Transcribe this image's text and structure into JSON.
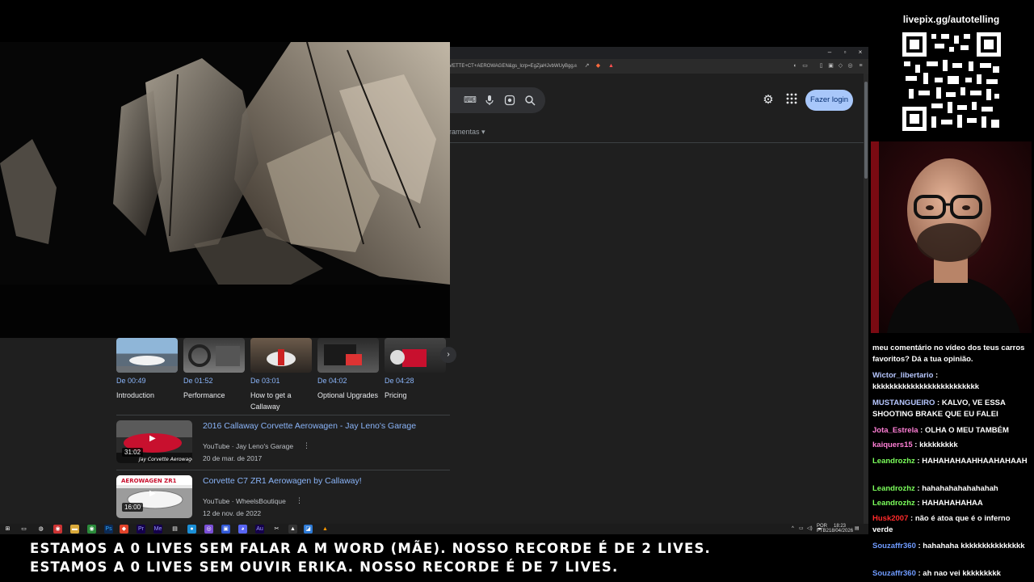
{
  "browser": {
    "url": "VETTE+CT+AEROWAGEN&gs_lcrp=EgZjaHJvbWUyBgg...",
    "tools_label": "ramentas",
    "login_label": "Fazer login",
    "window_controls": [
      "–",
      "▫",
      "×"
    ]
  },
  "chapters": [
    {
      "time": "De 00:49",
      "title": "Introduction"
    },
    {
      "time": "De 01:52",
      "title": "Performance"
    },
    {
      "time": "De 03:01",
      "title": "How to get a Callaway"
    },
    {
      "time": "De 04:02",
      "title": "Optional Upgrades"
    },
    {
      "time": "De 04:28",
      "title": "Pricing"
    }
  ],
  "results": [
    {
      "title": "2016 Callaway Corvette Aerowagen - Jay Leno's Garage",
      "source": "YouTube · Jay Leno's Garage",
      "date": "20 de mar. de 2017",
      "duration": "31:02"
    },
    {
      "title": "Corvette C7 ZR1 Aerowagen by Callaway!",
      "source": "YouTube · WheelsBoutique",
      "date": "12 de nov. de 2022",
      "duration": "16:00"
    }
  ],
  "taskbar": {
    "lang_top": "POR",
    "lang_bottom": "PTB2",
    "time": "18:23",
    "date": "18/04/2026"
  },
  "ticker": {
    "line1": "ESTAMOS A 0 LIVES SEM FALAR A M WORD (MÃE). NOSSO RECORDE É DE 2 LIVES.",
    "line2": "ESTAMOS A 0 LIVES SEM OUVIR ERIKA. NOSSO RECORDE É DE 7 LIVES."
  },
  "side": {
    "livepix_url": "livepix.gg/autotelling"
  },
  "chat": [
    {
      "user": "",
      "text": "meu comentário no vídeo dos teus carros favoritos? Dá a tua opinião.",
      "color": "#ffffff"
    },
    {
      "user": "Wictor_libertario",
      "text": " : kkkkkkkkkkkkkkkkkkkkkkkkk",
      "color": "#b7c7ff"
    },
    {
      "user": "MUSTANGUEIRO",
      "text": " : KALVO, VE ESSA SHOOTING BRAKE QUE EU FALEI",
      "color": "#b7c7ff"
    },
    {
      "user": "Jota_Estrela",
      "text": " : OLHA O MEU TAMBÉM",
      "color": "#ff7fd6"
    },
    {
      "user": "kaiquers15",
      "text": " : kkkkkkkkk",
      "color": "#ff7fd6"
    },
    {
      "user": "Leandrozhz",
      "text": " : HAHAHAHAAHHAAHAHAAH",
      "color": "#7cff5c"
    },
    {
      "user": "Leandrozhz",
      "text": " : hahahahahahahahah",
      "color": "#7cff5c"
    },
    {
      "user": "Leandrozhz",
      "text": " : HAHAHAHAHAA",
      "color": "#7cff5c"
    },
    {
      "user": "Husk2007",
      "text": " : não é atoa que é o inferno verde",
      "color": "#ff2a2a"
    },
    {
      "user": "Souzaffr360",
      "text": " : hahahaha kkkkkkkkkkkkkkk",
      "color": "#6f9bff"
    },
    {
      "user": "Souzaffr360",
      "text": " : ah nao vei kkkkkkkkk",
      "color": "#6f9bff"
    }
  ]
}
